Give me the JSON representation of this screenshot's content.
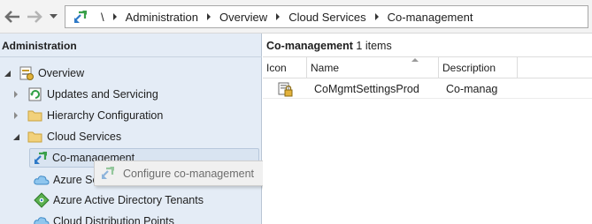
{
  "breadcrumb": {
    "root": "\\",
    "items": [
      "Administration",
      "Overview",
      "Cloud Services",
      "Co-management"
    ]
  },
  "navpane": {
    "title": "Administration",
    "items": [
      {
        "label": "Overview",
        "icon": "overview-icon"
      },
      {
        "label": "Updates and Servicing",
        "icon": "updates-icon"
      },
      {
        "label": "Hierarchy Configuration",
        "icon": "folder-icon"
      },
      {
        "label": "Cloud Services",
        "icon": "folder-icon"
      },
      {
        "label": "Co-management",
        "icon": "comanagement-icon"
      },
      {
        "label": "Azure Se",
        "icon": "cloud-icon"
      },
      {
        "label": "Azure Active Directory Tenants",
        "icon": "azure-ad-icon"
      },
      {
        "label": "Cloud Distribution Points",
        "icon": "cloud-icon"
      }
    ]
  },
  "context_menu": {
    "items": [
      {
        "label": "Configure co-management",
        "icon": "comanagement-icon"
      }
    ]
  },
  "listpane": {
    "title": "Co-management",
    "count": "1 items",
    "columns": [
      "Icon",
      "Name",
      "Description"
    ],
    "rows": [
      {
        "icon": "settings-lock-icon",
        "name": "CoMgmtSettingsProd",
        "description": "Co-manag"
      }
    ]
  },
  "colors": {
    "navpane_bg": "#e4ecf6",
    "selection_bg": "#d9e4f1",
    "addrbar_bg": "#f3f3f3"
  }
}
